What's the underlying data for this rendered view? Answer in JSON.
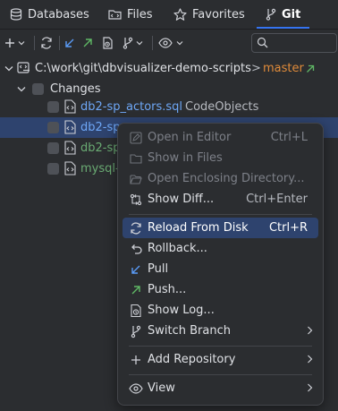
{
  "tabs": [
    {
      "label": "Databases",
      "icon": "databases-icon"
    },
    {
      "label": "Files",
      "icon": "folder-icon"
    },
    {
      "label": "Favorites",
      "icon": "star-icon"
    },
    {
      "label": "Git",
      "icon": "git-branch-icon",
      "active": true
    }
  ],
  "search": {
    "placeholder": ""
  },
  "tree": {
    "root": {
      "path": "C:\\work\\git\\dbvisualizer-demo-scripts",
      "separator": ">",
      "branch": "master"
    },
    "changes_label": "Changes",
    "files": [
      {
        "name": "db2-sp_actors.sql",
        "module": "CodeObjects",
        "color": "#6ea7f6"
      },
      {
        "name": "db2-sp",
        "module": "",
        "color": "#6ea7f6",
        "selected": true
      },
      {
        "name": "db2-sp",
        "module": "",
        "color": "#6aab73"
      },
      {
        "name": "mysql-",
        "module": "",
        "color": "#6aab73"
      }
    ]
  },
  "context_menu": {
    "items": [
      {
        "label": "Open in Editor",
        "shortcut": "Ctrl+L",
        "icon": "edit-icon",
        "disabled": true
      },
      {
        "label": "Show in Files",
        "shortcut": "",
        "icon": "files-icon",
        "disabled": true
      },
      {
        "label": "Open Enclosing Directory...",
        "shortcut": "",
        "icon": "folder-open-icon",
        "disabled": true
      },
      {
        "label": "Show Diff...",
        "shortcut": "Ctrl+Enter",
        "icon": "diff-icon",
        "disabled": false
      },
      {
        "label": "Reload From Disk",
        "shortcut": "Ctrl+R",
        "icon": "reload-icon",
        "highlighted": true
      },
      {
        "label": "Rollback...",
        "shortcut": "",
        "icon": "rollback-icon"
      },
      {
        "label": "Pull",
        "shortcut": "",
        "icon": "pull-icon"
      },
      {
        "label": "Push...",
        "shortcut": "",
        "icon": "push-icon"
      },
      {
        "label": "Show Log...",
        "shortcut": "",
        "icon": "log-icon"
      },
      {
        "label": "Switch Branch",
        "shortcut": "",
        "icon": "branch-icon",
        "submenu": true
      },
      {
        "label": "Add Repository",
        "shortcut": "",
        "icon": "plus-icon",
        "submenu": true
      },
      {
        "label": "View",
        "shortcut": "",
        "icon": "eye-icon",
        "submenu": true
      }
    ]
  },
  "colors": {
    "accent": "#3574f0",
    "selection": "#2e436e",
    "background": "#2b2d30",
    "branch": "#e08b3a"
  }
}
